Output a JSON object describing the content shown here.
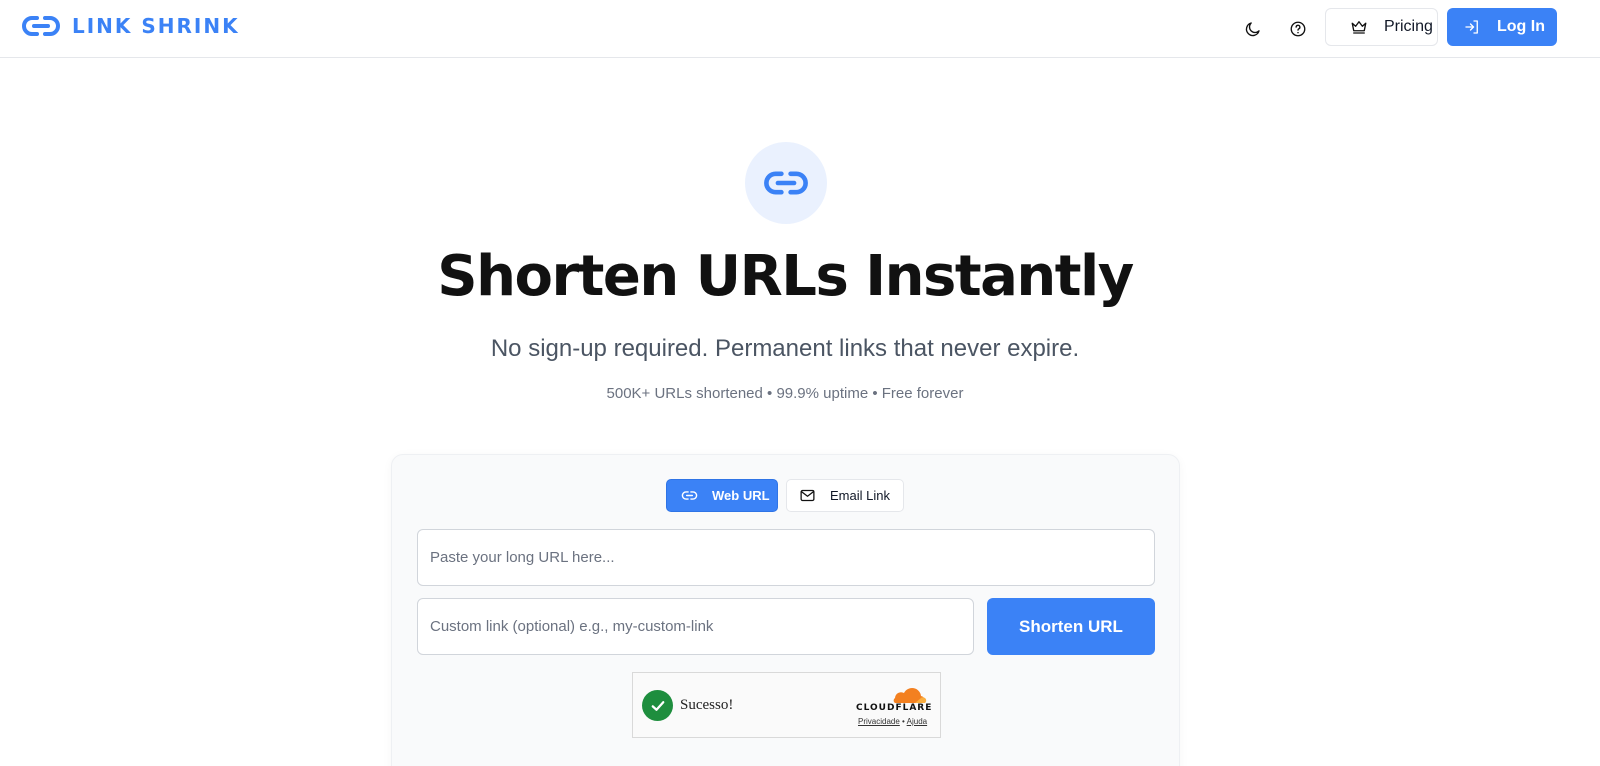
{
  "header": {
    "logo_text": "LINK SHRINK",
    "icons": [
      "moon-icon",
      "help-circle-icon"
    ],
    "pricing_label": "Pricing",
    "login_label": "Log In"
  },
  "hero": {
    "title": "Shorten URLs Instantly",
    "subtitle": "No sign-up required. Permanent links that never expire.",
    "stats": "500K+ URLs shortened • 99.9% uptime • Free forever"
  },
  "form": {
    "tabs": [
      {
        "label": "Web URL",
        "icon": "link-icon",
        "active": true
      },
      {
        "label": "Email Link",
        "icon": "mail-icon",
        "active": false
      }
    ],
    "url_placeholder": "Paste your long URL here...",
    "custom_placeholder": "Custom link (optional) e.g., my-custom-link",
    "submit_label": "Shorten URL"
  },
  "captcha": {
    "status": "Sucesso!",
    "brand": "CLOUDFLARE",
    "privacy_label": "Privacidade",
    "separator": "•",
    "help_label": "Ajuda"
  },
  "colors": {
    "accent": "#3b82f6",
    "success": "#1e8e3e",
    "cloudflare_orange": "#f38020"
  }
}
